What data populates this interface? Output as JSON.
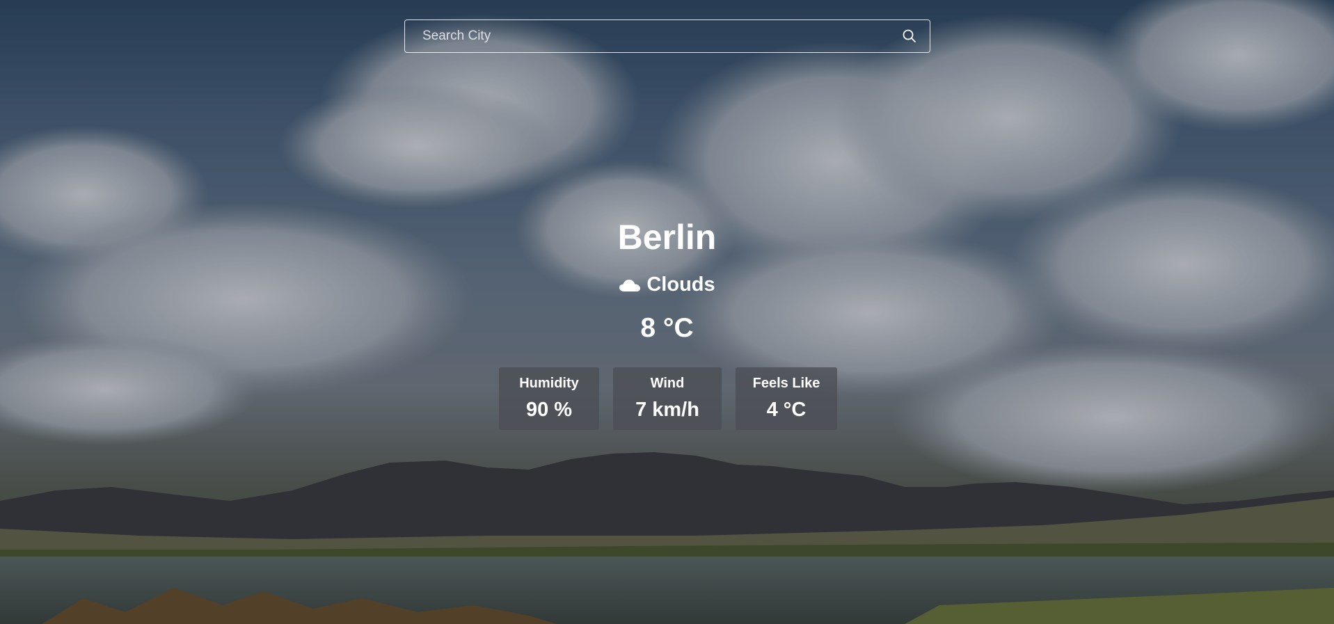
{
  "search": {
    "placeholder": "Search City",
    "value": ""
  },
  "weather": {
    "city": "Berlin",
    "condition": "Clouds",
    "condition_icon": "cloud-icon",
    "temperature": "8 °C"
  },
  "stats": [
    {
      "label": "Humidity",
      "value": "90 %"
    },
    {
      "label": "Wind",
      "value": "7 km/h"
    },
    {
      "label": "Feels Like",
      "value": "4 °C"
    }
  ],
  "icons": {
    "search": "search-icon",
    "condition": "cloud-icon"
  },
  "colors": {
    "text": "#ffffff",
    "card_bg": "#4b4e54"
  }
}
